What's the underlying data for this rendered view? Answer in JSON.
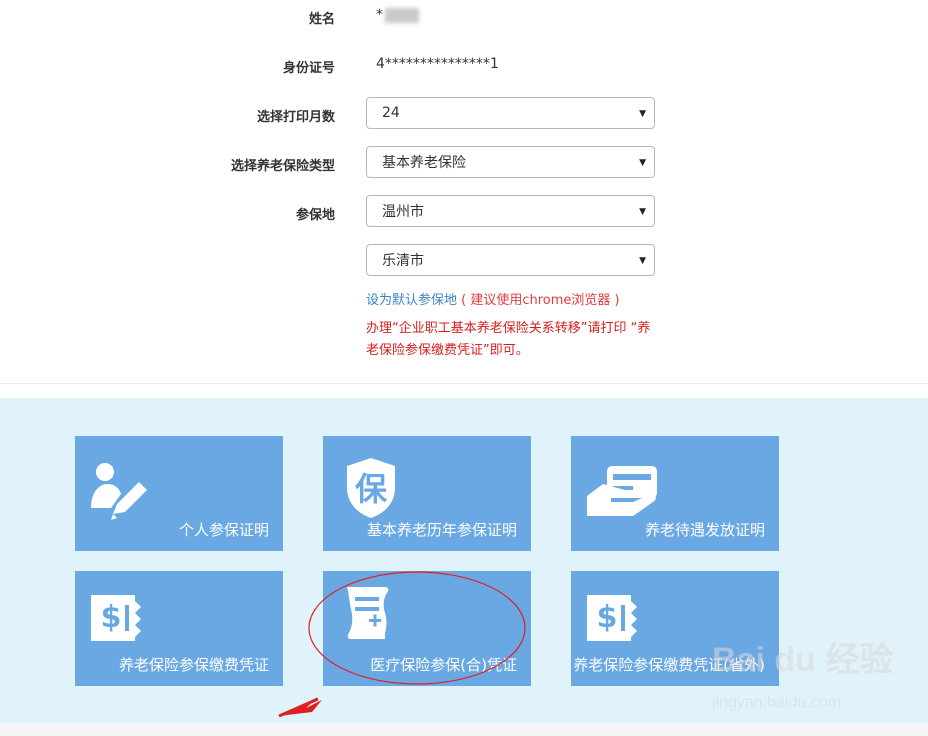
{
  "form": {
    "name_label": "姓名",
    "name_value_prefix": "*",
    "id_label": "身份证号",
    "id_value": "4***************1",
    "months_label": "选择打印月数",
    "months_value": "24",
    "insurance_type_label": "选择养老保险类型",
    "insurance_type_value": "基本养老保险",
    "location_label": "参保地",
    "location_city": "温州市",
    "location_district": "乐清市",
    "set_default_link": "设为默认参保地",
    "browser_hint": "( 建议使用chrome浏览器 )",
    "notice": "办理“企业职工基本养老保险关系转移”请打印 “养老保险参保缴费凭证”即可。"
  },
  "tiles": [
    {
      "label": "个人参保证明",
      "icon": "person-edit-icon"
    },
    {
      "label": "基本养老历年参保证明",
      "icon": "shield-bao-icon",
      "icon_char": "保"
    },
    {
      "label": "养老待遇发放证明",
      "icon": "card-hand-icon"
    },
    {
      "label": "养老保险参保缴费凭证",
      "icon": "dollar-receipt-icon"
    },
    {
      "label": "医疗保险参保(合)凭证",
      "icon": "medical-document-icon"
    },
    {
      "label": "养老保险参保缴费凭证(省外)",
      "icon": "dollar-receipt-icon"
    }
  ],
  "watermark": {
    "brand": "Bai du 经验",
    "url": "jingyan.baidu.com"
  },
  "colors": {
    "tile_bg": "#6aa8e4",
    "tiles_area_bg": "#e0f3fb",
    "link": "#3a86c8",
    "notice": "#d81e1e",
    "annotation": "#e02020"
  }
}
